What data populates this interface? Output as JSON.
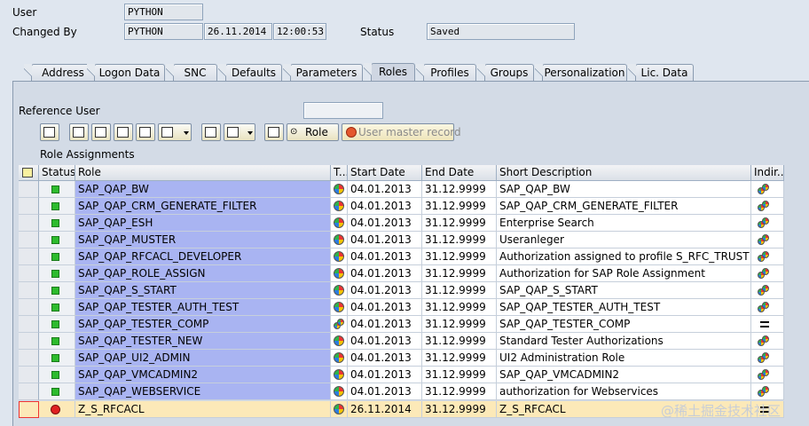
{
  "header": {
    "user_label": "User",
    "user_value": "PYTHON",
    "changed_by_label": "Changed By",
    "changed_by_value": "PYTHON",
    "changed_date": "26.11.2014",
    "changed_time": "12:00:53",
    "status_label": "Status",
    "status_value": "Saved"
  },
  "tabs": [
    "Address",
    "Logon Data",
    "SNC",
    "Defaults",
    "Parameters",
    "Roles",
    "Profiles",
    "Groups",
    "Personalization",
    "Lic. Data"
  ],
  "active_tab": "Roles",
  "reference_user_label": "Reference User",
  "reference_user_value": "",
  "toolbar": {
    "role_button_label": "Role",
    "user_master_record_label": "User master record"
  },
  "section_title": "Role Assignments",
  "table": {
    "columns": [
      "Status",
      "Role",
      "T...",
      "Start Date",
      "End Date",
      "Short Description",
      "Indir..."
    ],
    "rows": [
      {
        "status": "green",
        "role": "SAP_QAP_BW",
        "type": "single",
        "start": "04.01.2013",
        "end": "31.12.9999",
        "desc": "SAP_QAP_BW",
        "indirect": "composite-icon"
      },
      {
        "status": "green",
        "role": "SAP_QAP_CRM_GENERATE_FILTER",
        "type": "single",
        "start": "04.01.2013",
        "end": "31.12.9999",
        "desc": "SAP_QAP_CRM_GENERATE_FILTER",
        "indirect": "composite-icon"
      },
      {
        "status": "green",
        "role": "SAP_QAP_ESH",
        "type": "single",
        "start": "04.01.2013",
        "end": "31.12.9999",
        "desc": "Enterprise Search",
        "indirect": "composite-icon"
      },
      {
        "status": "green",
        "role": "SAP_QAP_MUSTER",
        "type": "single",
        "start": "04.01.2013",
        "end": "31.12.9999",
        "desc": "Useranleger",
        "indirect": "composite-icon"
      },
      {
        "status": "green",
        "role": "SAP_QAP_RFCACL_DEVELOPER",
        "type": "single",
        "start": "04.01.2013",
        "end": "31.12.9999",
        "desc": "Authorization assigned to profile S_RFC_TRUST fo...",
        "indirect": "composite-icon"
      },
      {
        "status": "green",
        "role": "SAP_QAP_ROLE_ASSIGN",
        "type": "single",
        "start": "04.01.2013",
        "end": "31.12.9999",
        "desc": "Authorization for SAP Role Assignment",
        "indirect": "composite-icon"
      },
      {
        "status": "green",
        "role": "SAP_QAP_S_START",
        "type": "single",
        "start": "04.01.2013",
        "end": "31.12.9999",
        "desc": "SAP_QAP_S_START",
        "indirect": "composite-icon"
      },
      {
        "status": "green",
        "role": "SAP_QAP_TESTER_AUTH_TEST",
        "type": "single",
        "start": "04.01.2013",
        "end": "31.12.9999",
        "desc": "SAP_QAP_TESTER_AUTH_TEST",
        "indirect": "composite-icon"
      },
      {
        "status": "green",
        "role": "SAP_QAP_TESTER_COMP",
        "type": "composite",
        "start": "04.01.2013",
        "end": "31.12.9999",
        "desc": "SAP_QAP_TESTER_COMP",
        "indirect": "equals-icon"
      },
      {
        "status": "green",
        "role": "SAP_QAP_TESTER_NEW",
        "type": "single",
        "start": "04.01.2013",
        "end": "31.12.9999",
        "desc": "Standard Tester Authorizations",
        "indirect": "composite-icon"
      },
      {
        "status": "green",
        "role": "SAP_QAP_UI2_ADMIN",
        "type": "single",
        "start": "04.01.2013",
        "end": "31.12.9999",
        "desc": "UI2 Administration Role",
        "indirect": "composite-icon"
      },
      {
        "status": "green",
        "role": "SAP_QAP_VMCADMIN2",
        "type": "single",
        "start": "04.01.2013",
        "end": "31.12.9999",
        "desc": "SAP_QAP_VMCADMIN2",
        "indirect": "composite-icon"
      },
      {
        "status": "green",
        "role": "SAP_QAP_WEBSERVICE",
        "type": "single",
        "start": "04.01.2013",
        "end": "31.12.9999",
        "desc": "authorization for Webservices",
        "indirect": "composite-icon"
      },
      {
        "status": "red",
        "role": "Z_S_RFCACL",
        "type": "single",
        "start": "26.11.2014",
        "end": "31.12.9999",
        "desc": "Z_S_RFCACL",
        "indirect": "equals-icon"
      }
    ]
  },
  "watermark": "@稀土掘金技术社区"
}
